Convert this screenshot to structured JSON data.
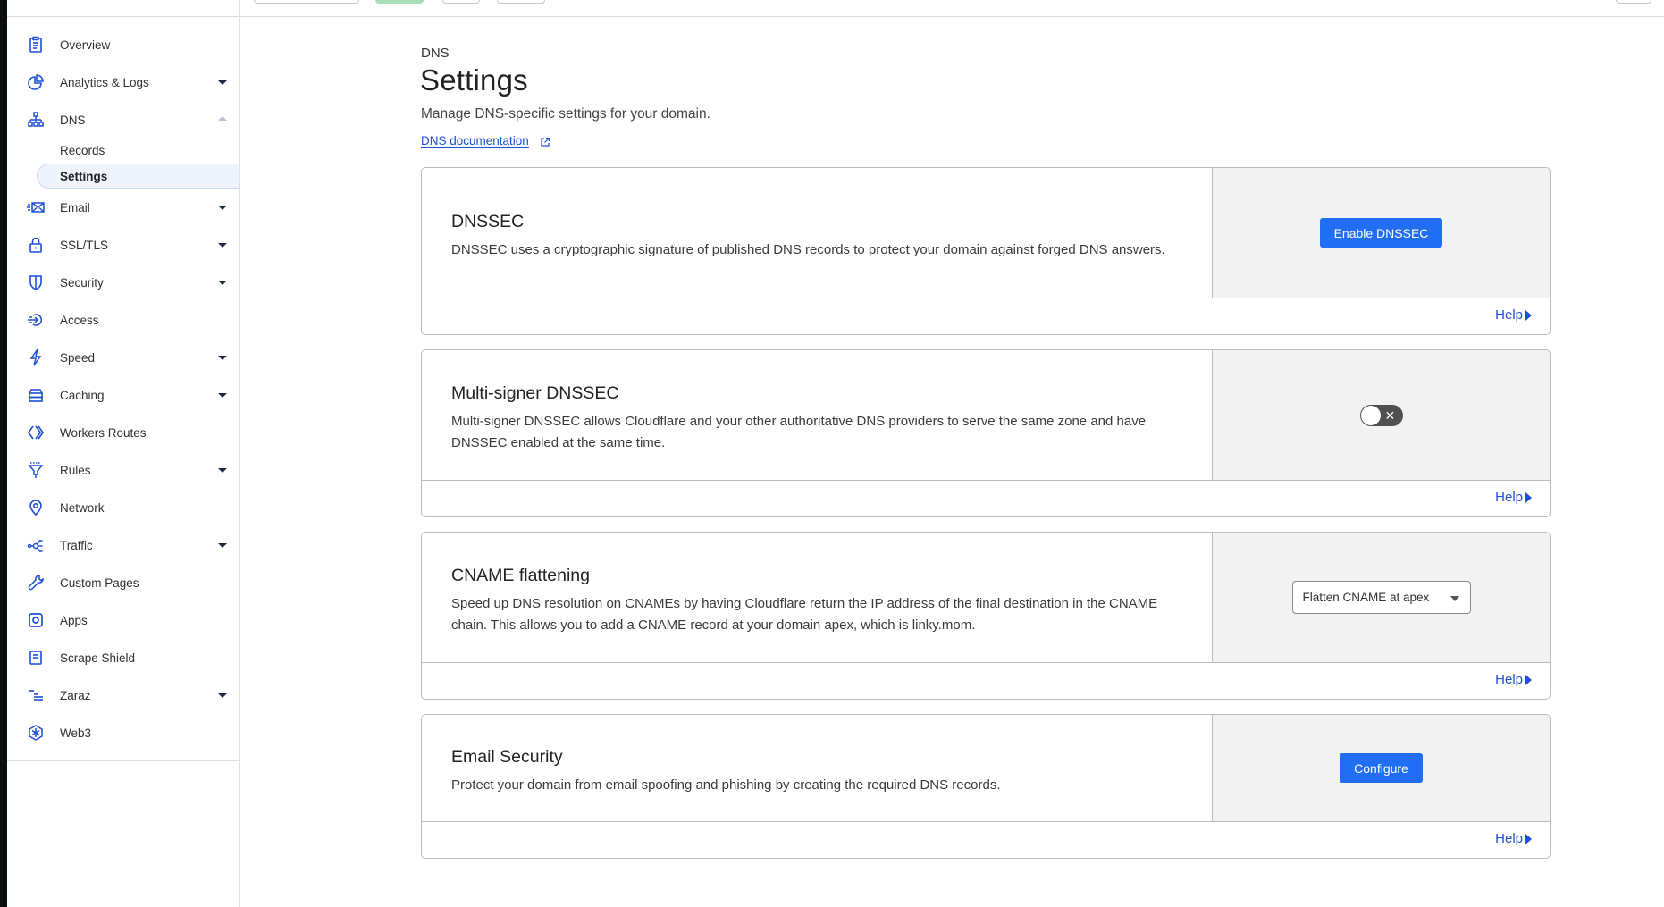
{
  "sidebar": {
    "items": [
      {
        "label": "Overview",
        "icon": "clipboard-icon",
        "has_caret": false
      },
      {
        "label": "Analytics & Logs",
        "icon": "pie-chart-icon",
        "has_caret": true
      },
      {
        "label": "DNS",
        "icon": "sitemap-icon",
        "has_caret": true,
        "expanded": true,
        "children": [
          {
            "label": "Records",
            "active": false
          },
          {
            "label": "Settings",
            "active": true
          }
        ]
      },
      {
        "label": "Email",
        "icon": "email-icon",
        "has_caret": true
      },
      {
        "label": "SSL/TLS",
        "icon": "lock-icon",
        "has_caret": true
      },
      {
        "label": "Security",
        "icon": "shield-icon",
        "has_caret": true
      },
      {
        "label": "Access",
        "icon": "access-icon",
        "has_caret": false
      },
      {
        "label": "Speed",
        "icon": "lightning-icon",
        "has_caret": true
      },
      {
        "label": "Caching",
        "icon": "server-stack-icon",
        "has_caret": true
      },
      {
        "label": "Workers Routes",
        "icon": "workers-icon",
        "has_caret": false
      },
      {
        "label": "Rules",
        "icon": "funnel-icon",
        "has_caret": true
      },
      {
        "label": "Network",
        "icon": "location-pin-icon",
        "has_caret": false
      },
      {
        "label": "Traffic",
        "icon": "traffic-icon",
        "has_caret": true
      },
      {
        "label": "Custom Pages",
        "icon": "wrench-icon",
        "has_caret": false
      },
      {
        "label": "Apps",
        "icon": "apps-icon",
        "has_caret": false
      },
      {
        "label": "Scrape Shield",
        "icon": "document-icon",
        "has_caret": false
      },
      {
        "label": "Zaraz",
        "icon": "zaraz-icon",
        "has_caret": true
      },
      {
        "label": "Web3",
        "icon": "web3-icon",
        "has_caret": false
      }
    ]
  },
  "page": {
    "breadcrumb": "DNS",
    "title": "Settings",
    "subtitle": "Manage DNS-specific settings for your domain.",
    "doc_link": "DNS documentation"
  },
  "cards": [
    {
      "title": "DNSSEC",
      "description": "DNSSEC uses a cryptographic signature of published DNS records to protect your domain against forged DNS answers.",
      "control": {
        "type": "button",
        "label": "Enable DNSSEC"
      },
      "help": "Help"
    },
    {
      "title": "Multi-signer DNSSEC",
      "description": "Multi-signer DNSSEC allows Cloudflare and your other authoritative DNS providers to serve the same zone and have DNSSEC enabled at the same time.",
      "control": {
        "type": "toggle",
        "state": "off",
        "off_glyph": "✕"
      },
      "help": "Help"
    },
    {
      "title": "CNAME flattening",
      "description": "Speed up DNS resolution on CNAMEs by having Cloudflare return the IP address of the final destination in the CNAME chain. This allows you to add a CNAME record at your domain apex, which is linky.mom.",
      "control": {
        "type": "select",
        "selected": "Flatten CNAME at apex"
      },
      "help": "Help"
    },
    {
      "title": "Email Security",
      "description": "Protect your domain from email spoofing and phishing by creating the required DNS records.",
      "control": {
        "type": "button",
        "label": "Configure"
      },
      "help": "Help"
    }
  ],
  "colors": {
    "accent": "#1d4fd7",
    "button": "#216ef5",
    "panel_bg": "#f2f2f2",
    "toggle_off": "#505050"
  }
}
